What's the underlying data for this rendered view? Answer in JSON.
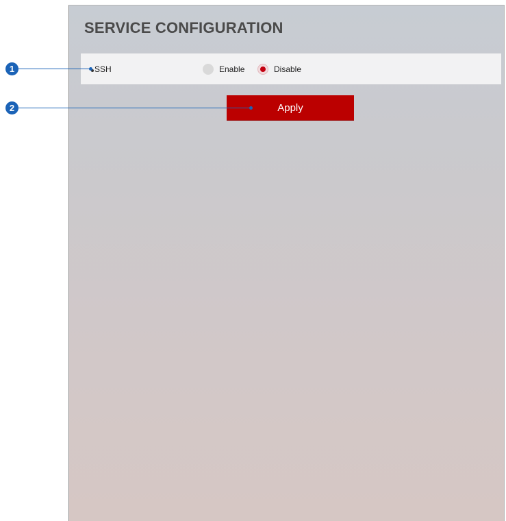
{
  "panel": {
    "title": "SERVICE CONFIGURATION"
  },
  "ssh": {
    "label": "SSH",
    "options": [
      {
        "label": "Enable",
        "selected": false
      },
      {
        "label": "Disable",
        "selected": true
      }
    ]
  },
  "apply_button": {
    "label": "Apply",
    "color": "#bb0000"
  },
  "callouts": [
    {
      "number": "1"
    },
    {
      "number": "2"
    }
  ],
  "colors": {
    "callout": "#1b63b7",
    "radio_selected": "#c30010"
  }
}
